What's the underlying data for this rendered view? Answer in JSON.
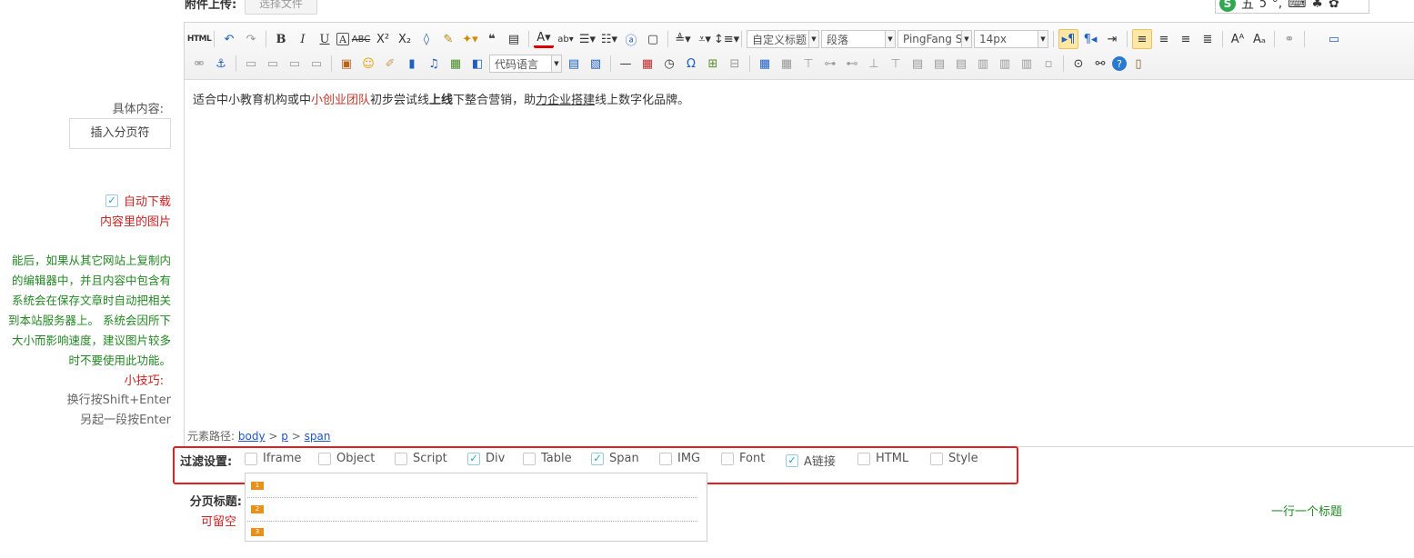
{
  "attachment": {
    "label": "附件上传:",
    "button": "选择文件"
  },
  "ime": {
    "logo": "S",
    "items": [
      "五",
      "ↄ",
      "°,",
      "⌨",
      "♣",
      "✿"
    ]
  },
  "left": {
    "content_label": "具体内容:",
    "insert_pagebreak": "插入分页符",
    "auto_download_1": "自动下载",
    "auto_download_2": "内容里的图片",
    "tip_lines": [
      "能后，如果从其它网站上复制内",
      "的编辑器中，并且内容中包含有",
      "系统会在保存文章时自动把相关",
      "到本站服务器上。 系统会因所下",
      "大小而影响速度，建议图片较多",
      "时不要使用此功能。"
    ],
    "tip_trick": "小技巧:",
    "tip_gray": [
      "换行按Shift+Enter",
      "另起一段按Enter"
    ]
  },
  "toolbar": {
    "html_label": "HTML",
    "heading_select": "自定义标题",
    "paragraph_select": "段落",
    "font_select": "PingFang S",
    "size_select": "14px",
    "code_select": "代码语言"
  },
  "content": {
    "p1": "适合中小教育机构或中",
    "p_red": "小创业团队",
    "p2": "初步尝试线",
    "p_bold": "上线",
    "p3": "下整合营销，助",
    "p_under": "力企业搭建",
    "p4": "线上数字化品牌。"
  },
  "element_path": {
    "label": "元素路径:",
    "body": "body",
    "gt1": ">",
    "p": "p",
    "gt2": ">",
    "span": "span"
  },
  "filter": {
    "label": "过滤设置:",
    "items": [
      {
        "label": "Iframe",
        "checked": false
      },
      {
        "label": "Object",
        "checked": false
      },
      {
        "label": "Script",
        "checked": false
      },
      {
        "label": "Div",
        "checked": true
      },
      {
        "label": "Table",
        "checked": false
      },
      {
        "label": "Span",
        "checked": true
      },
      {
        "label": "IMG",
        "checked": false
      },
      {
        "label": "Font",
        "checked": false
      },
      {
        "label": "A链接",
        "checked": true
      },
      {
        "label": "HTML",
        "checked": false
      },
      {
        "label": "Style",
        "checked": false
      }
    ]
  },
  "page_title": {
    "label": "分页标题:",
    "optional": "可留空",
    "numbers": [
      "1",
      "2",
      "3"
    ],
    "hint": "一行一个标题"
  },
  "colors": {
    "accent_red": "#e02020",
    "green": "#228822",
    "check_blue": "#1a9fd0"
  }
}
